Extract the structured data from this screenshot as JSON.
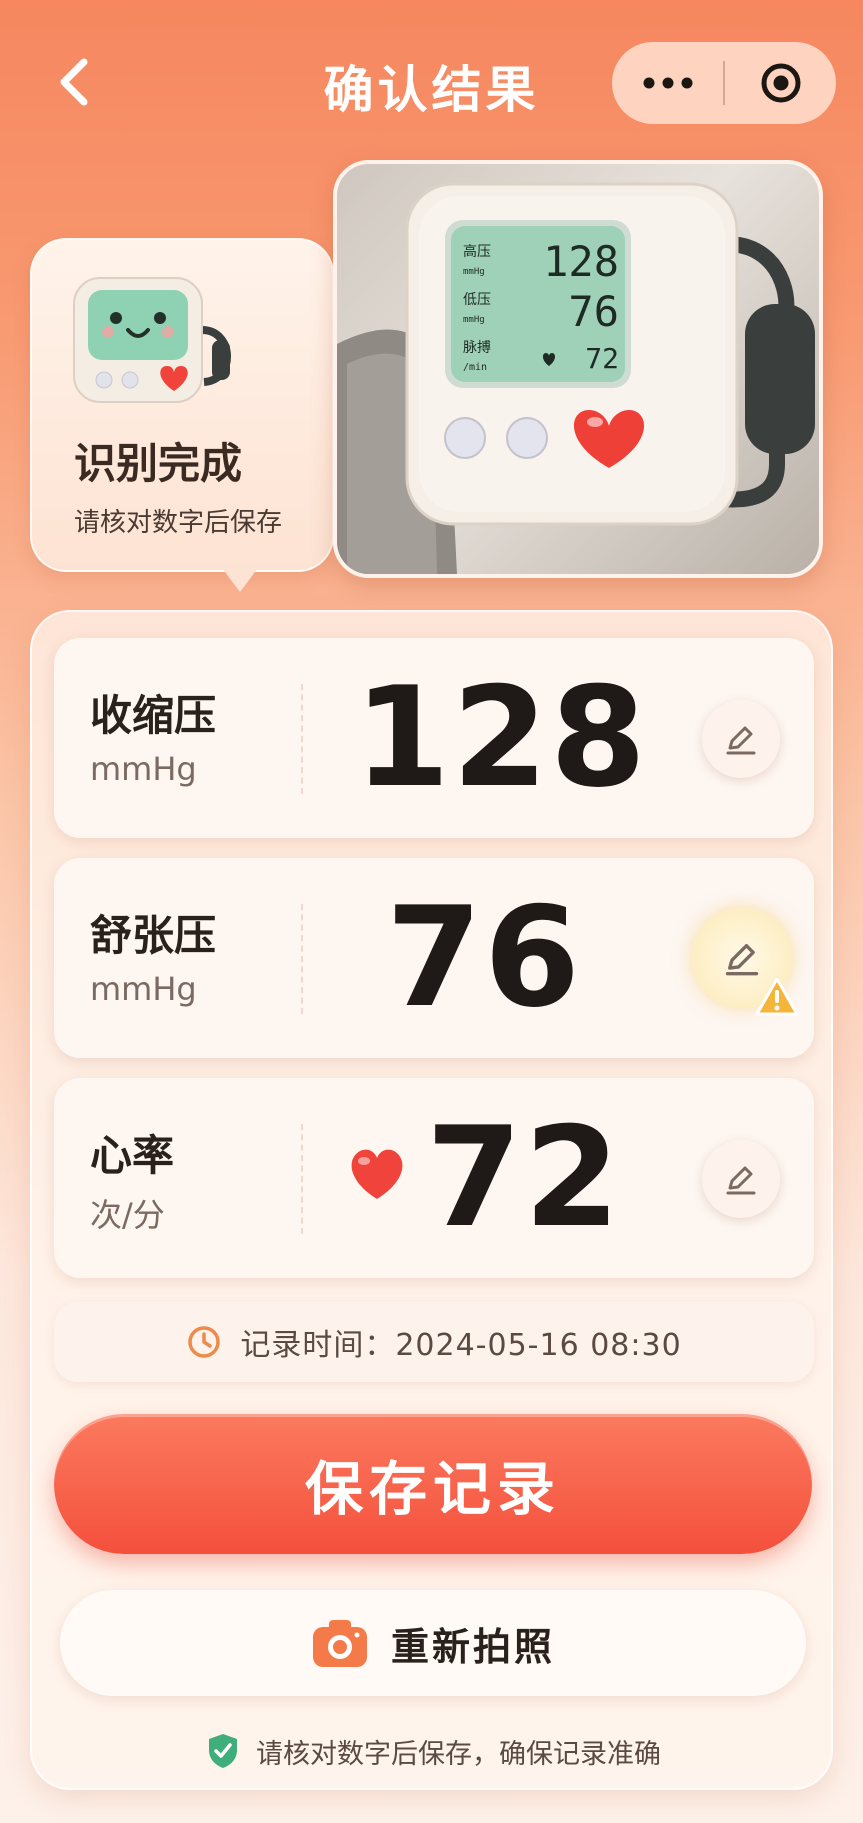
{
  "header": {
    "title": "确认结果",
    "back_icon": "chevron-left-icon",
    "menu_icon": "more-dots-icon",
    "close_icon": "target-icon"
  },
  "recognition": {
    "title": "识别完成",
    "subtitle": "请核对数字后保存"
  },
  "device_display": {
    "systolic_label": "高压",
    "systolic_unit": "mmHg",
    "systolic_value": "128",
    "diastolic_label": "低压",
    "diastolic_unit": "mmHg",
    "diastolic_value": "76",
    "pulse_label": "脉搏",
    "pulse_unit": "/min",
    "pulse_value": "72"
  },
  "readings": [
    {
      "label": "收缩压",
      "unit": "mmHg",
      "value": "128",
      "warning": false
    },
    {
      "label": "舒张压",
      "unit": "mmHg",
      "value": "76",
      "warning": true
    },
    {
      "label": "心率",
      "unit": "次/分",
      "value": "72",
      "warning": false
    }
  ],
  "record_time": "记录时间：2024-05-16  08:30",
  "save_label": "保存记录",
  "retake_label": "重新拍照",
  "hint": "请核对数字后保存，确保记录准确",
  "colors": {
    "accent": "#f4503c",
    "warning": "#f5b53a",
    "shield": "#3fae7a",
    "clock": "#f08a4b"
  }
}
